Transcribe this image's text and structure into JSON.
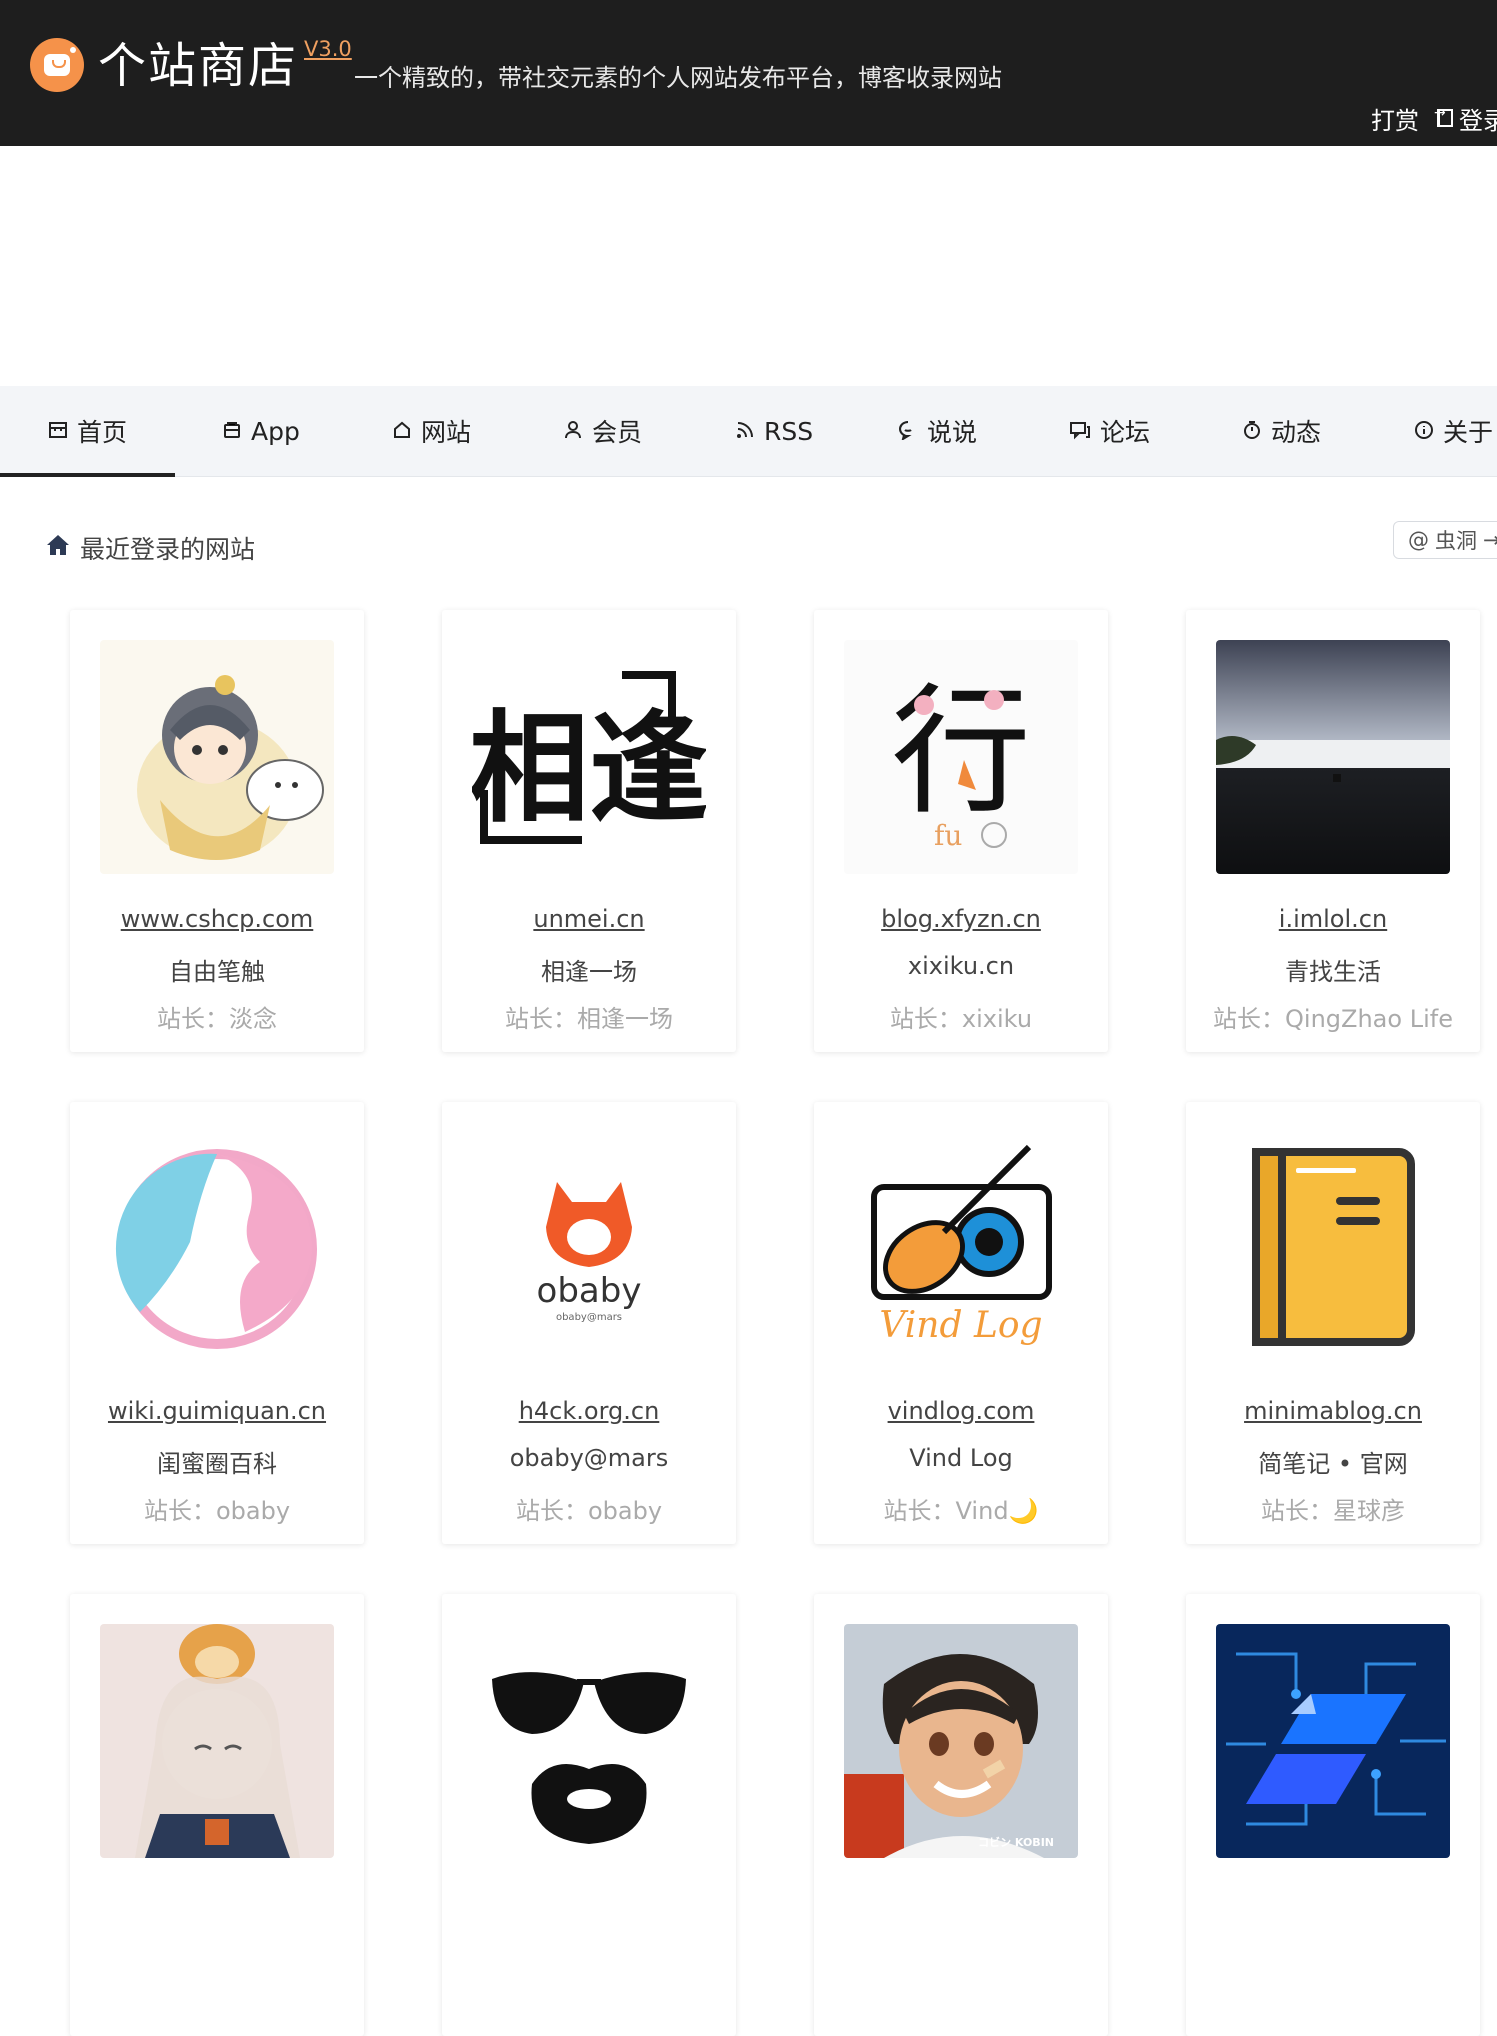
{
  "header": {
    "title": "个站商店",
    "version": "V3.0",
    "tagline": "一个精致的，带社交元素的个人网站发布平台，博客收录网站",
    "tip_label": "打赏",
    "login_label": "登录"
  },
  "nav": {
    "items": [
      {
        "label": "首页",
        "icon": "store-icon"
      },
      {
        "label": "App",
        "icon": "app-icon"
      },
      {
        "label": "网站",
        "icon": "house-icon"
      },
      {
        "label": "会员",
        "icon": "user-icon"
      },
      {
        "label": "RSS",
        "icon": "rss-icon"
      },
      {
        "label": "说说",
        "icon": "chat-icon"
      },
      {
        "label": "论坛",
        "icon": "forum-icon"
      },
      {
        "label": "动态",
        "icon": "timer-icon"
      },
      {
        "label": "关于",
        "icon": "info-icon"
      }
    ],
    "active_index": 0
  },
  "section": {
    "title": "最近登录的网站",
    "wormhole_label": "虫洞"
  },
  "owner_prefix": "站长：",
  "sites": [
    {
      "domain": "www.cshcp.com",
      "name": "自由笔触",
      "owner": "站长：淡念"
    },
    {
      "domain": "unmei.cn",
      "name": "相逢一场",
      "owner": "站长：相逢一场"
    },
    {
      "domain": "blog.xfyzn.cn",
      "name": "xixiku.cn",
      "owner": "站长：xixiku"
    },
    {
      "domain": "i.imlol.cn",
      "name": "青找生活",
      "owner": "站长：QingZhao Life"
    },
    {
      "domain": "wiki.guimiquan.cn",
      "name": "闺蜜圈百科",
      "owner": "站长：obaby"
    },
    {
      "domain": "h4ck.org.cn",
      "name": "obaby@mars",
      "owner": "站长：obaby"
    },
    {
      "domain": "vindlog.com",
      "name": "Vind Log",
      "owner": "站长：Vind🌙"
    },
    {
      "domain": "minimablog.cn",
      "name": "简笔记 • 官网",
      "owner": "站长：星球彦"
    },
    {
      "domain": "",
      "name": "",
      "owner": ""
    },
    {
      "domain": "",
      "name": "",
      "owner": ""
    },
    {
      "domain": "",
      "name": "",
      "owner": ""
    },
    {
      "domain": "",
      "name": "",
      "owner": ""
    }
  ],
  "thumb_text": {
    "unmei": "相逢",
    "xfyzn": "行",
    "xfyzn_small": "fu",
    "obaby": "obaby",
    "obaby_small": "obaby@mars",
    "vind": "Vind Log",
    "kobin": "コビン KOBIN"
  },
  "colors": {
    "header_bg": "#1e1e1e",
    "accent": "#f5924a",
    "nav_bg": "#f3f5f8"
  }
}
